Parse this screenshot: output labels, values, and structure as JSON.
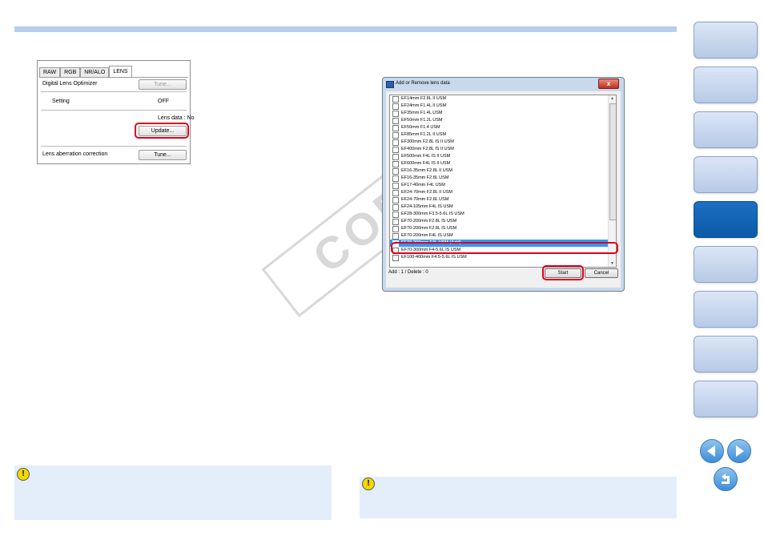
{
  "lens_panel": {
    "tabs": [
      "RAW",
      "RGB",
      "NR/ALO",
      "LENS"
    ],
    "dlo_label": "Digital Lens Optimizer",
    "tune_label": "Tune...",
    "setting_label": "Setting",
    "setting_value": "OFF",
    "lens_data_label": "Lens data : No",
    "update_label": "Update...",
    "aberration_label": "Lens aberration correction",
    "tune2_label": "Tune..."
  },
  "dialog": {
    "title": "Add or Remove lens data",
    "close_label": "x",
    "lenses": [
      {
        "name": "EF14mm F2.8L II USM",
        "checked": false
      },
      {
        "name": "EF24mm F1.4L II USM",
        "checked": false
      },
      {
        "name": "EF35mm F1.4L USM",
        "checked": false
      },
      {
        "name": "EF50mm F1.2L USM",
        "checked": false
      },
      {
        "name": "EF50mm F1.4 USM",
        "checked": false
      },
      {
        "name": "EF85mm F1.2L II USM",
        "checked": false
      },
      {
        "name": "EF300mm F2.8L IS II USM",
        "checked": false
      },
      {
        "name": "EF400mm F2.8L IS II USM",
        "checked": false
      },
      {
        "name": "EF500mm F4L IS II USM",
        "checked": false
      },
      {
        "name": "EF600mm F4L IS II USM",
        "checked": false
      },
      {
        "name": "EF16-35mm F2.8L II USM",
        "checked": false
      },
      {
        "name": "EF16-35mm F2.8L USM",
        "checked": false
      },
      {
        "name": "EF17-40mm F4L USM",
        "checked": false
      },
      {
        "name": "EF24-70mm F2.8L II USM",
        "checked": false
      },
      {
        "name": "EF24-70mm F2.8L USM",
        "checked": false
      },
      {
        "name": "EF24-105mm F4L IS USM",
        "checked": false
      },
      {
        "name": "EF28-300mm F3.5-5.6L IS USM",
        "checked": false
      },
      {
        "name": "EF70-200mm F2.8L IS USM",
        "checked": false
      },
      {
        "name": "EF70-200mm F2.8L IS USM",
        "checked": false
      },
      {
        "name": "EF70-200mm F4L IS USM",
        "checked": false
      },
      {
        "name": "EF70-200mm F4L USM (Add)",
        "checked": true,
        "selected": true
      },
      {
        "name": "EF70-300mm F4-5.6L IS USM",
        "checked": false
      },
      {
        "name": "EF100-400mm F4.5-5.6L IS USM",
        "checked": false
      }
    ],
    "status": "Add : 1 / Delete : 0",
    "start_label": "Start",
    "cancel_label": "Cancel"
  },
  "watermark": "COPY",
  "notes": {
    "icon_glyph": "!"
  },
  "colors": {
    "accent": "#b6cdf0",
    "selection": "#3297f7",
    "highlight": "#e0001a",
    "nav_active": "#0b5aa8",
    "note_bg": "#e4eefb"
  }
}
